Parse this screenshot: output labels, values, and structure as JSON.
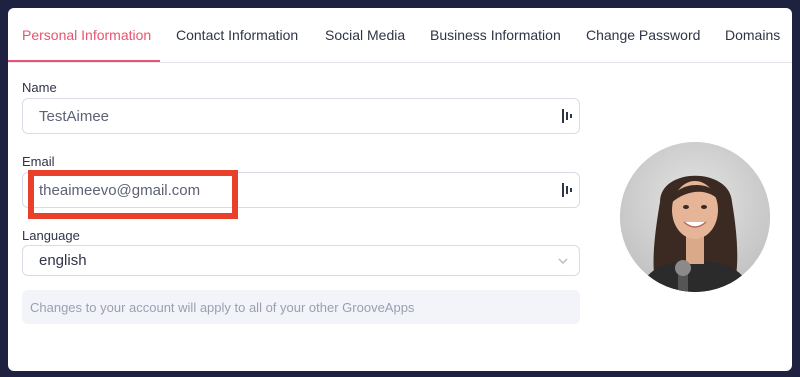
{
  "tabs": [
    {
      "label": "Personal Information",
      "active": true
    },
    {
      "label": "Contact Information",
      "active": false
    },
    {
      "label": "Social Media",
      "active": false
    },
    {
      "label": "Business Information",
      "active": false
    },
    {
      "label": "Change Password",
      "active": false
    },
    {
      "label": "Domains",
      "active": false
    }
  ],
  "form": {
    "name": {
      "label": "Name",
      "value": "TestAimee",
      "icon": "password-manager-icon"
    },
    "email": {
      "label": "Email",
      "value": "theaimeevo@gmail.com",
      "icon": "password-manager-icon"
    },
    "language": {
      "label": "Language",
      "selected": "english",
      "icon": "chevron-down-icon"
    }
  },
  "note": "Changes to your account will apply to all of your other GrooveApps",
  "colors": {
    "accent": "#e8546f",
    "highlight_box": "#e8402a",
    "background": "#1f2140"
  }
}
